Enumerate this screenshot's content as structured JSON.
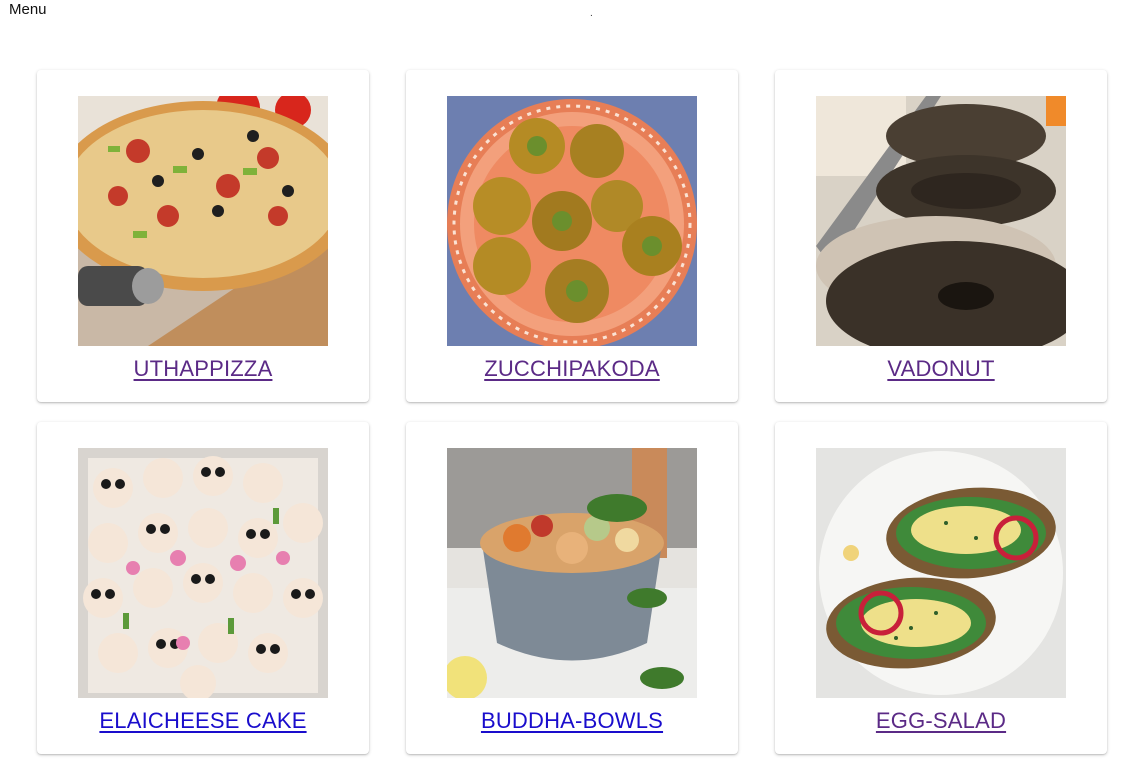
{
  "header": {
    "title": "Menu",
    "dot": "."
  },
  "dishes": [
    {
      "name": "UTHAPPIZZA",
      "image_icon": "pizza-image",
      "link_color": "#5b2a86"
    },
    {
      "name": "ZUCCHIPAKODA",
      "image_icon": "pakoda-image",
      "link_color": "#5b2a86"
    },
    {
      "name": "VADONUT",
      "image_icon": "donut-image",
      "link_color": "#5b2a86"
    },
    {
      "name": "ELAICHEESE CAKE",
      "image_icon": "cupcakes-image",
      "link_color": "#1a0dcc"
    },
    {
      "name": "BUDDHA-BOWLS",
      "image_icon": "bowl-image",
      "link_color": "#1a0dcc"
    },
    {
      "name": "EGG-SALAD",
      "image_icon": "egg-toast-image",
      "link_color": "#5b2a86"
    }
  ]
}
